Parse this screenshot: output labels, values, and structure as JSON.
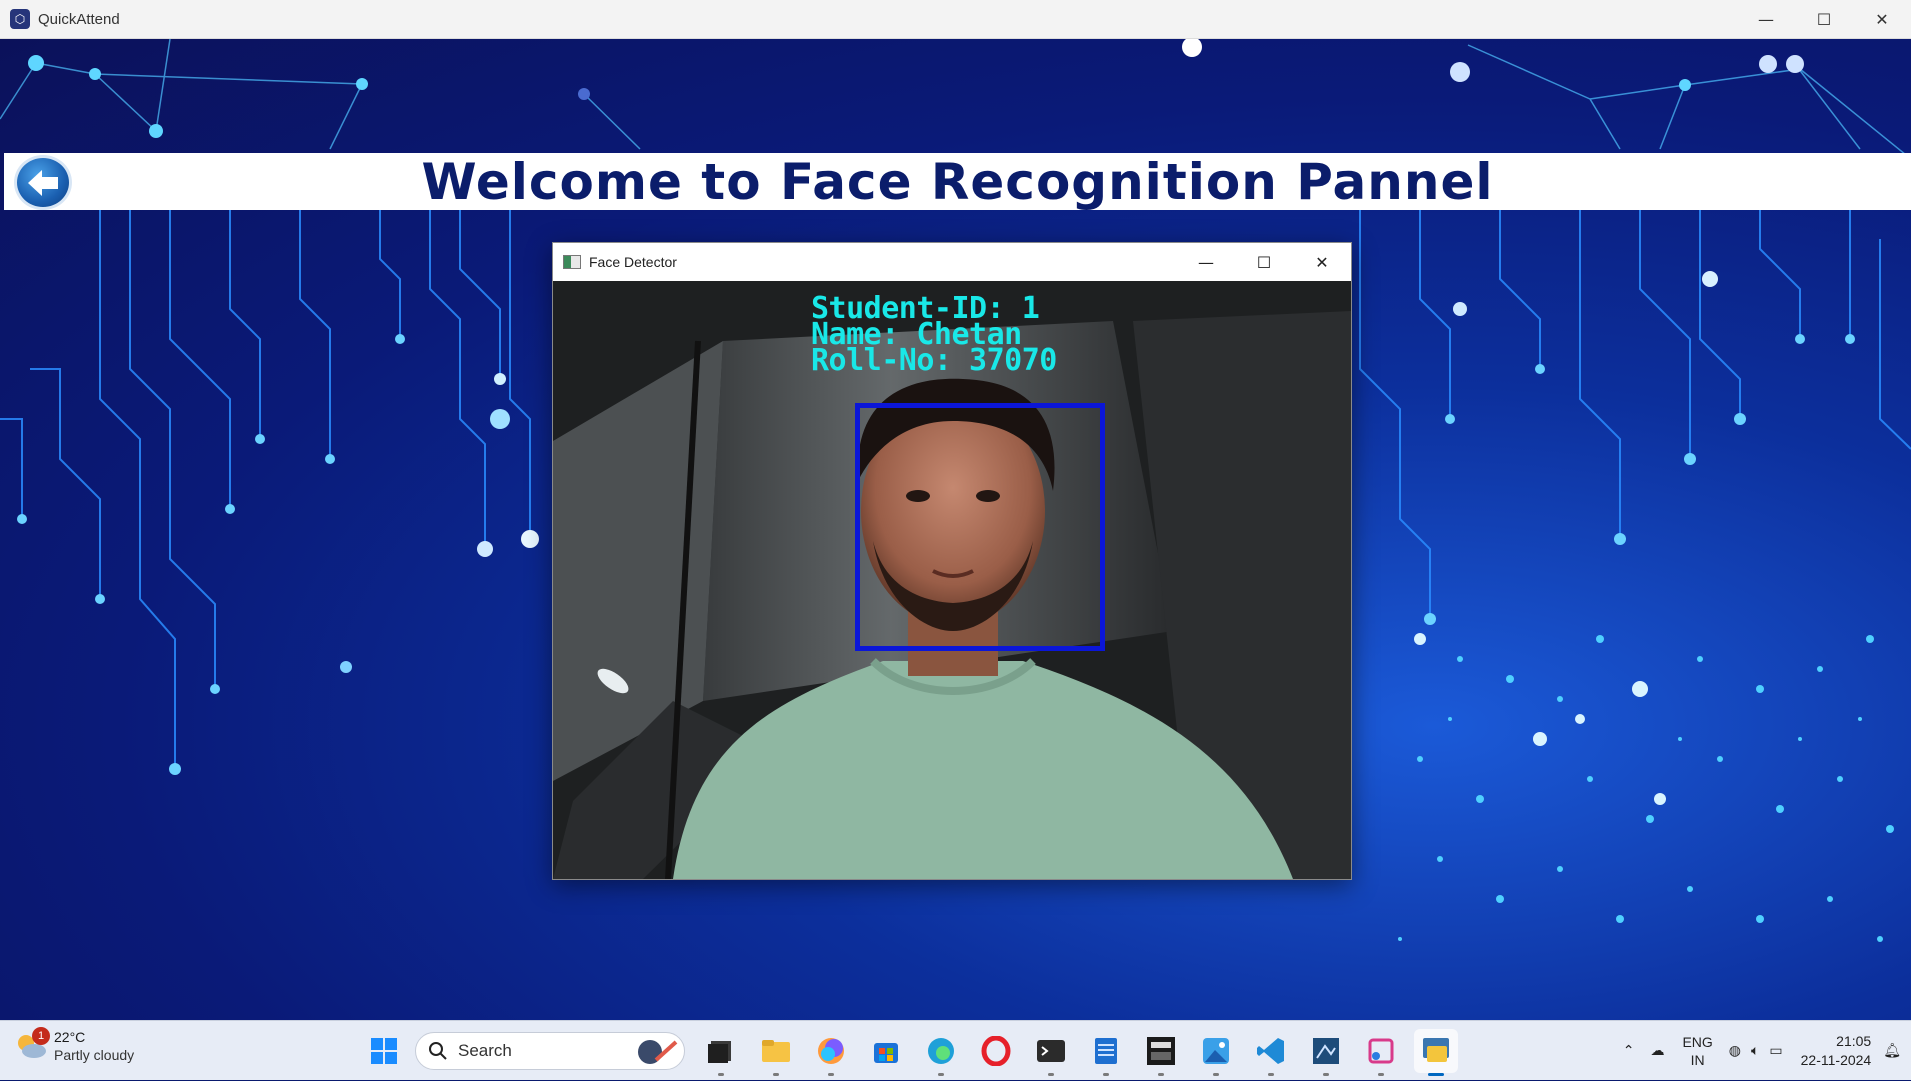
{
  "app": {
    "title": "QuickAttend",
    "controls": {
      "minimize": "—",
      "maximize": "☐",
      "close": "✕"
    }
  },
  "banner": {
    "title": "Welcome to Face Recognition Pannel",
    "back_icon": "back-arrow-icon"
  },
  "face_detector": {
    "title": "Face Detector",
    "controls": {
      "minimize": "—",
      "maximize": "☐",
      "close": "✕"
    },
    "overlay": {
      "student_id": "Student-ID: 1",
      "name": "Name: Chetan",
      "roll_no": "Roll-No: 37070"
    },
    "box_color": "#0b16d8",
    "text_color": "#19e8e8"
  },
  "taskbar": {
    "weather": {
      "temp": "22°C",
      "desc": "Partly cloudy",
      "badge": "1"
    },
    "search_placeholder": "Search",
    "apps": [
      "start-icon",
      "file-explorer-icon",
      "copilot-icon",
      "microsoft-store-icon",
      "edge-icon",
      "opera-icon",
      "terminal-icon",
      "notepad-icon",
      "app-icon",
      "photos-icon",
      "vscode-icon",
      "sql-icon",
      "snipping-tool-icon",
      "python-icon"
    ],
    "tray": {
      "lang_top": "ENG",
      "lang_bottom": "IN",
      "time": "21:05",
      "date": "22-11-2024"
    }
  }
}
